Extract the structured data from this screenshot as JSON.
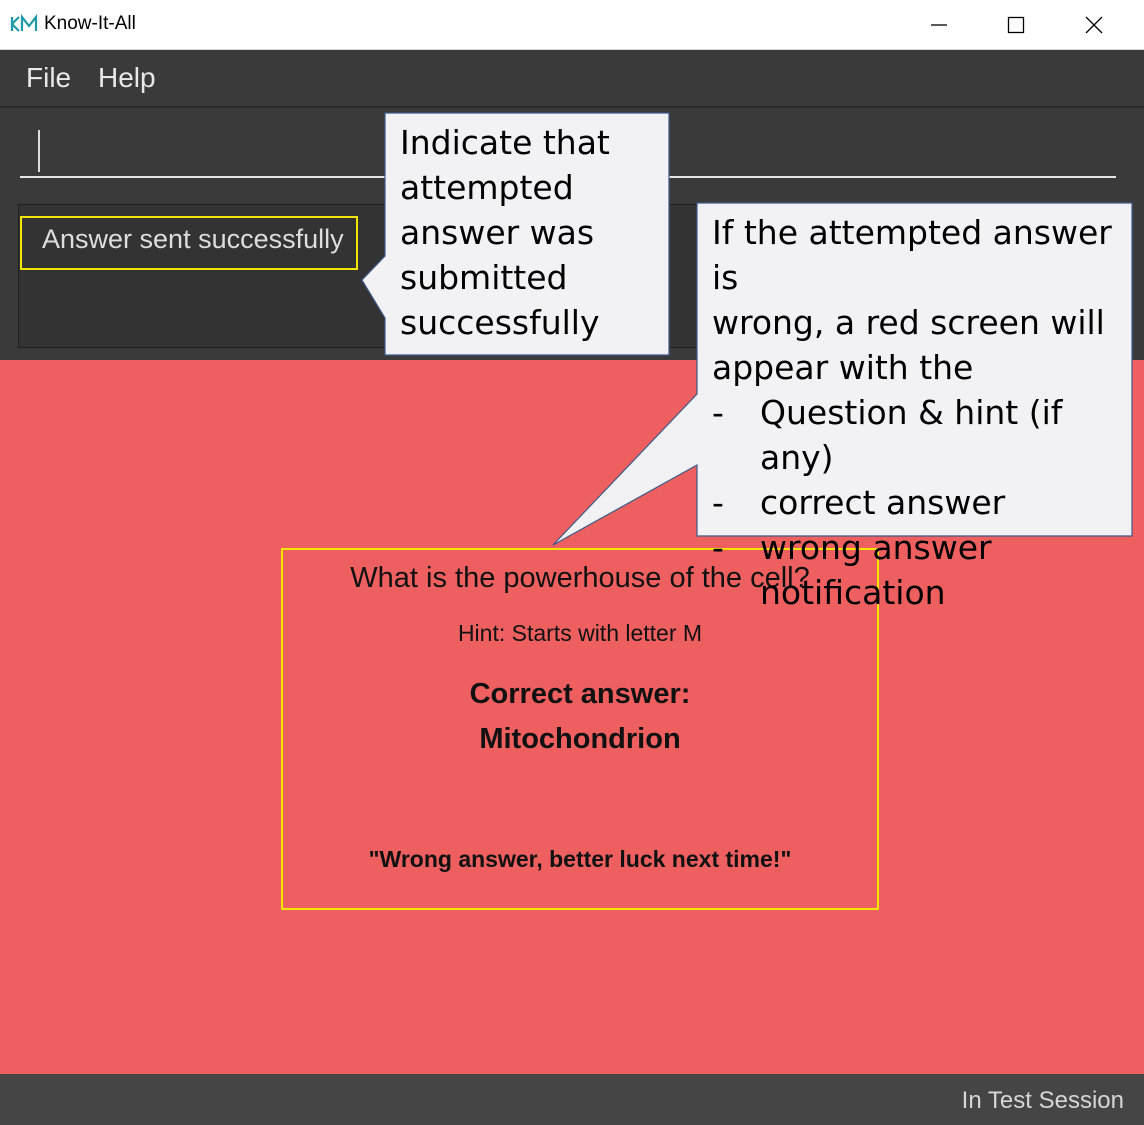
{
  "window": {
    "title": "Know-It-All",
    "controls": [
      "minimize",
      "maximize",
      "close"
    ]
  },
  "menu": {
    "items": [
      {
        "label": "File"
      },
      {
        "label": "Help"
      }
    ]
  },
  "command_box": {
    "value": ""
  },
  "result_display": {
    "message": "Answer sent successfully"
  },
  "question_card": {
    "question": "What is the powerhouse of the cell?",
    "hint": "Hint: Starts with letter M",
    "correct_label": "Correct answer:",
    "correct_answer": "Mitochondrion",
    "wrong_message": "\"Wrong answer, better luck next time!\""
  },
  "status_bar": {
    "text": "In Test Session"
  },
  "callouts": {
    "left": {
      "lines": [
        "Indicate that",
        "attempted",
        "answer was",
        "submitted",
        "successfully"
      ]
    },
    "right": {
      "lines": [
        "If the attempted answer is",
        "wrong, a red screen will",
        "appear with the"
      ],
      "bullets": [
        {
          "dash": "-",
          "text": "Question & hint (if any)"
        },
        {
          "dash": "-",
          "text": "correct answer"
        },
        {
          "dash": "-",
          "text": "wrong answer notification"
        }
      ]
    }
  },
  "colors": {
    "app_dark": "#3a3a3a",
    "wrong_screen": "#ee6060",
    "highlight": "#f2e600",
    "status_bar": "#454545",
    "callout_fill": "#f2f2f4",
    "callout_border": "#3c5a8a"
  }
}
